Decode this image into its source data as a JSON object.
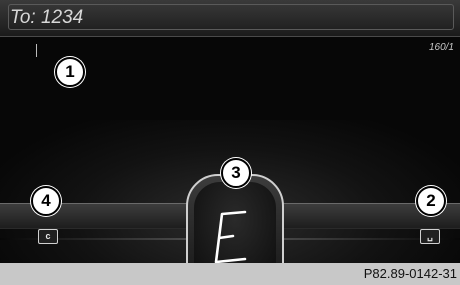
{
  "header": {
    "to_label": "To: 1234"
  },
  "message": {
    "counter": "160/1"
  },
  "callouts": {
    "c1": "1",
    "c2": "2",
    "c3": "3",
    "c4": "4"
  },
  "keys": {
    "clear": "c",
    "space": "␣"
  },
  "handwriting": {
    "glyph": "E"
  },
  "caption": "P82.89-0142-31",
  "colors": {
    "screen_bg": "#070707",
    "header_bg": "#2b2b2b",
    "text": "#d8d8d8",
    "caption_bg": "#c8c8c8"
  }
}
